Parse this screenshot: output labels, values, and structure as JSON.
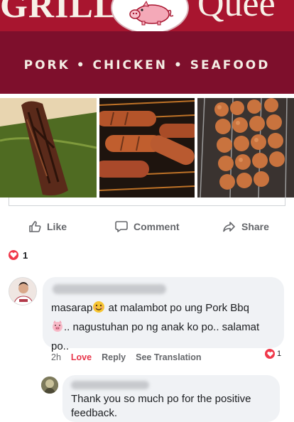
{
  "banner": {
    "left_word": "GRILL",
    "right_word": "Quee",
    "tagline": "PORK • CHICKEN • SEAFOOD",
    "logo_icon": "pig-logo-icon",
    "colors": {
      "top": "#a8152f",
      "strip": "#7e0f2c",
      "text": "#f4ede4"
    }
  },
  "photos": [
    {
      "icon": "grilled-pork-photo"
    },
    {
      "icon": "grilled-sausages-photo"
    },
    {
      "icon": "meatball-skewers-photo"
    }
  ],
  "actions": {
    "like_label": "Like",
    "comment_label": "Comment",
    "share_label": "Share"
  },
  "reactions": {
    "count": "1",
    "icon": "heart-icon"
  },
  "comments": [
    {
      "author_blurred": true,
      "text_part1": "masarap",
      "text_part2": " at malambot po ung Pork Bbq",
      "text_part3": ".. nagustuhan po ng anak ko po.. salamat po..",
      "time": "2h",
      "love_label": "Love",
      "reply_label": "Reply",
      "translate_label": "See Translation",
      "reaction_count": "1"
    }
  ],
  "reply": {
    "author_blurred": true,
    "text": "Thank you so much po for the positive feedback."
  }
}
